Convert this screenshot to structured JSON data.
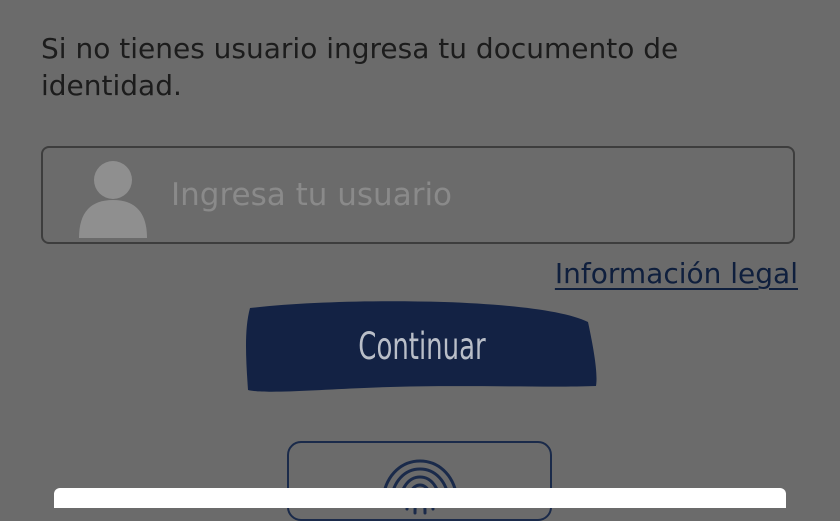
{
  "login": {
    "instructions": "Si no tienes usuario ingresa tu documento de identidad.",
    "user_field": {
      "placeholder": "Ingresa tu usuario",
      "value": "",
      "icon": "user-icon"
    },
    "legal_link": "Información legal",
    "continue_label": "Continuar",
    "fingerprint_icon": "fingerprint-icon"
  },
  "colors": {
    "overlay_background": "#6b6b6b",
    "brand_navy": "#132244",
    "button_text": "#b9bec8",
    "placeholder_text": "#8a8a8a",
    "bottom_sheet": "#ffffff"
  }
}
